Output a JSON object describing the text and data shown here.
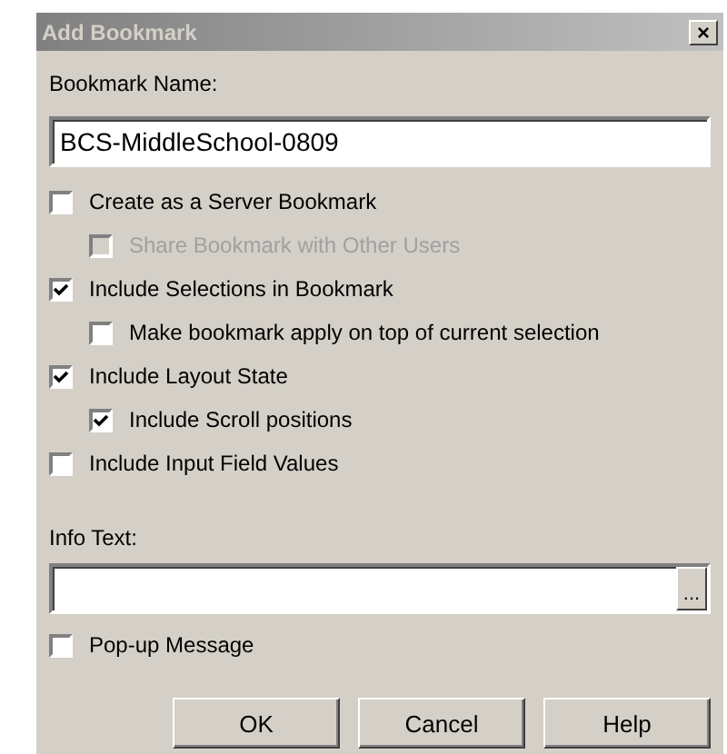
{
  "window": {
    "title": "Add Bookmark",
    "close_button": "×"
  },
  "name_label": "Bookmark Name:",
  "name_value": "BCS-MiddleSchool-0809",
  "options": [
    {
      "label": "Create as a Server Bookmark",
      "checked": false,
      "disabled": false,
      "children": [
        {
          "label": "Share Bookmark with Other Users",
          "checked": false,
          "disabled": true
        }
      ]
    },
    {
      "label": "Include Selections in Bookmark",
      "checked": true,
      "disabled": false,
      "children": [
        {
          "label": "Make bookmark apply on top of current selection",
          "checked": false,
          "disabled": false
        }
      ]
    },
    {
      "label": "Include Layout State",
      "checked": true,
      "disabled": false,
      "children": [
        {
          "label": "Include Scroll positions",
          "checked": true,
          "disabled": false
        }
      ]
    },
    {
      "label": "Include Input Field Values",
      "checked": false,
      "disabled": false
    }
  ],
  "info_label": "Info Text:",
  "info_browse": "...",
  "popup": {
    "label": "Pop-up Message",
    "checked": false
  },
  "buttons": [
    "OK",
    "Cancel",
    "Help"
  ]
}
